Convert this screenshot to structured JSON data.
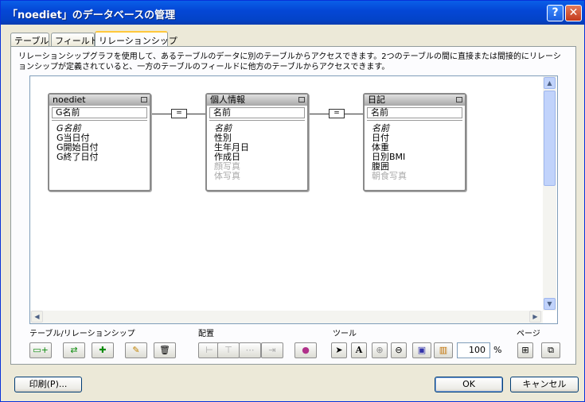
{
  "window": {
    "title": "「noediet」のデータベースの管理"
  },
  "tabs": [
    "テーブル",
    "フィールド",
    "リレーションシップ"
  ],
  "description": "リレーションシップグラフを使用して、あるテーブルのデータに別のテーブルからアクセスできます。2つのテーブルの間に直接または間接的にリレーションシップが定義されていると、一方のテーブルのフィールドに他方のテーブルからアクセスできます。",
  "tables": [
    {
      "name": "noediet",
      "key": "G名前",
      "fields": [
        "G名前",
        "G当日付",
        "G開始日付",
        "G終了日付"
      ]
    },
    {
      "name": "個人情報",
      "key": "名前",
      "fields": [
        "名前",
        "性別",
        "生年月日",
        "作成日",
        "顔写真",
        "体写真"
      ]
    },
    {
      "name": "日記",
      "key": "名前",
      "fields": [
        "名前",
        "日付",
        "体重",
        "日別BMI",
        "腹囲",
        "朝食写真"
      ]
    }
  ],
  "relation_symbol": "=",
  "toolbar": {
    "group_table": "テーブル/リレーションシップ",
    "group_arrange": "配置",
    "group_tools": "ツール",
    "group_page": "ページ",
    "zoom": "100",
    "percent": "%"
  },
  "buttons": {
    "print": "印刷(P)...",
    "ok": "OK",
    "cancel": "キャンセル"
  }
}
